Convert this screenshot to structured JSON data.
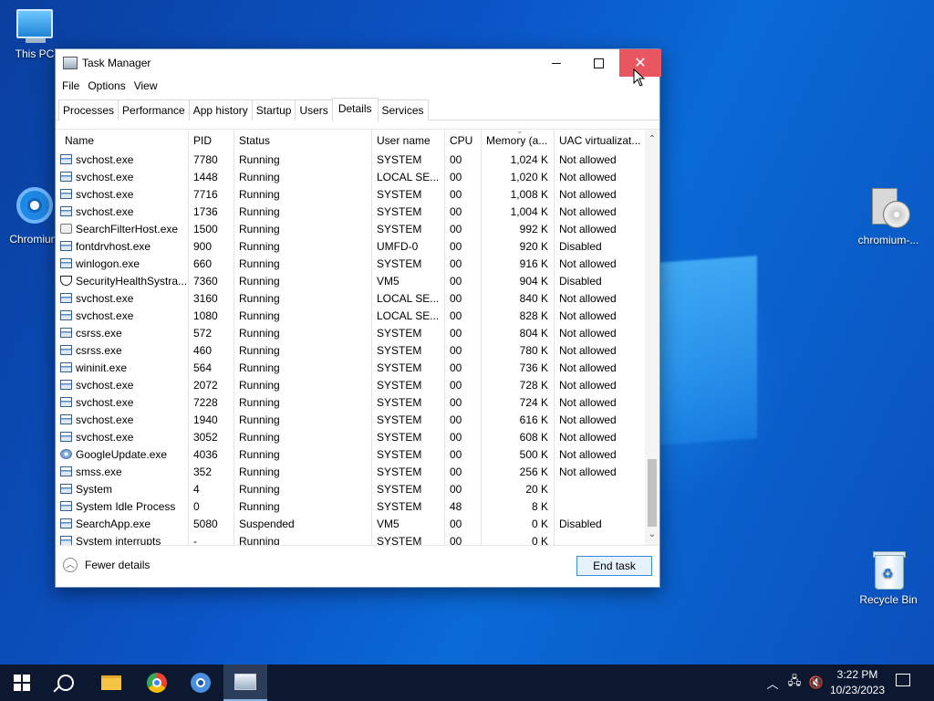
{
  "desktop": {
    "icons": [
      {
        "label": "This PC"
      },
      {
        "label": "Chromium"
      },
      {
        "label": "chromium-..."
      },
      {
        "label": "Recycle Bin"
      }
    ]
  },
  "window": {
    "title": "Task Manager",
    "close_color": "#e8565f",
    "menu": [
      "File",
      "Options",
      "View"
    ],
    "tabs": [
      "Processes",
      "Performance",
      "App history",
      "Startup",
      "Users",
      "Details",
      "Services"
    ],
    "active_tab": "Details",
    "columns": [
      "Name",
      "PID",
      "Status",
      "User name",
      "CPU",
      "Memory (a...",
      "UAC virtualizat..."
    ],
    "rows": [
      [
        "svchost.exe",
        "7780",
        "Running",
        "SYSTEM",
        "00",
        "1,024 K",
        "Not allowed"
      ],
      [
        "svchost.exe",
        "1448",
        "Running",
        "LOCAL SE...",
        "00",
        "1,020 K",
        "Not allowed"
      ],
      [
        "svchost.exe",
        "7716",
        "Running",
        "SYSTEM",
        "00",
        "1,008 K",
        "Not allowed"
      ],
      [
        "svchost.exe",
        "1736",
        "Running",
        "SYSTEM",
        "00",
        "1,004 K",
        "Not allowed"
      ],
      [
        "SearchFilterHost.exe",
        "1500",
        "Running",
        "SYSTEM",
        "00",
        "992 K",
        "Not allowed"
      ],
      [
        "fontdrvhost.exe",
        "900",
        "Running",
        "UMFD-0",
        "00",
        "920 K",
        "Disabled"
      ],
      [
        "winlogon.exe",
        "660",
        "Running",
        "SYSTEM",
        "00",
        "916 K",
        "Not allowed"
      ],
      [
        "SecurityHealthSystra...",
        "7360",
        "Running",
        "VM5",
        "00",
        "904 K",
        "Disabled"
      ],
      [
        "svchost.exe",
        "3160",
        "Running",
        "LOCAL SE...",
        "00",
        "840 K",
        "Not allowed"
      ],
      [
        "svchost.exe",
        "1080",
        "Running",
        "LOCAL SE...",
        "00",
        "828 K",
        "Not allowed"
      ],
      [
        "csrss.exe",
        "572",
        "Running",
        "SYSTEM",
        "00",
        "804 K",
        "Not allowed"
      ],
      [
        "csrss.exe",
        "460",
        "Running",
        "SYSTEM",
        "00",
        "780 K",
        "Not allowed"
      ],
      [
        "wininit.exe",
        "564",
        "Running",
        "SYSTEM",
        "00",
        "736 K",
        "Not allowed"
      ],
      [
        "svchost.exe",
        "2072",
        "Running",
        "SYSTEM",
        "00",
        "728 K",
        "Not allowed"
      ],
      [
        "svchost.exe",
        "7228",
        "Running",
        "SYSTEM",
        "00",
        "724 K",
        "Not allowed"
      ],
      [
        "svchost.exe",
        "1940",
        "Running",
        "SYSTEM",
        "00",
        "616 K",
        "Not allowed"
      ],
      [
        "svchost.exe",
        "3052",
        "Running",
        "SYSTEM",
        "00",
        "608 K",
        "Not allowed"
      ],
      [
        "GoogleUpdate.exe",
        "4036",
        "Running",
        "SYSTEM",
        "00",
        "500 K",
        "Not allowed"
      ],
      [
        "smss.exe",
        "352",
        "Running",
        "SYSTEM",
        "00",
        "256 K",
        "Not allowed"
      ],
      [
        "System",
        "4",
        "Running",
        "SYSTEM",
        "00",
        "20 K",
        ""
      ],
      [
        "System Idle Process",
        "0",
        "Running",
        "SYSTEM",
        "48",
        "8 K",
        ""
      ],
      [
        "SearchApp.exe",
        "5080",
        "Suspended",
        "VM5",
        "00",
        "0 K",
        "Disabled"
      ],
      [
        "System interrupts",
        "-",
        "Running",
        "SYSTEM",
        "00",
        "0 K",
        ""
      ]
    ],
    "row_icons": [
      "app",
      "app",
      "app",
      "app",
      "search",
      "app",
      "app",
      "shield",
      "app",
      "app",
      "app",
      "app",
      "app",
      "app",
      "app",
      "app",
      "app",
      "google",
      "app",
      "app",
      "app",
      "app",
      "app"
    ],
    "fewer_details": "Fewer details",
    "end_task": "End task"
  },
  "taskbar": {
    "items": [
      "start-icon",
      "search-icon",
      "file-explorer-icon",
      "chrome-icon",
      "chromium-icon",
      "task-manager-icon"
    ],
    "active": "task-manager-icon",
    "time": "3:22 PM",
    "date": "10/23/2023"
  }
}
